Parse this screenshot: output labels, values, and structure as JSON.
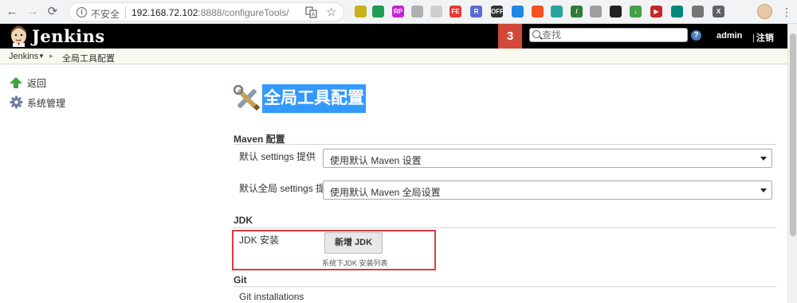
{
  "browser": {
    "security_label": "不安全",
    "url_host": "192.168.72.102",
    "url_rest": ":8888/configureTools/",
    "nav_back": "←",
    "nav_forward": "→",
    "nav_reload": "⟳",
    "extensions": [
      {
        "icon": "extension-icon",
        "color": "#c8b21a",
        "text": ""
      },
      {
        "icon": "extension-icon",
        "color": "#1f9d55",
        "text": ""
      },
      {
        "icon": "extension-icon",
        "color": "#c026d3",
        "text": "RP"
      },
      {
        "icon": "extension-icon",
        "color": "#b0b0b0",
        "text": ""
      },
      {
        "icon": "extension-icon",
        "color": "#cfcfcf",
        "text": ""
      },
      {
        "icon": "extension-icon",
        "color": "#e53935",
        "text": "FE"
      },
      {
        "icon": "extension-icon",
        "color": "#5b6bd6",
        "text": "R"
      },
      {
        "icon": "extension-icon",
        "color": "#333333",
        "text": "OFF"
      },
      {
        "icon": "extension-icon",
        "color": "#1e88e5",
        "text": ""
      },
      {
        "icon": "extension-icon",
        "color": "#f4511e",
        "text": ""
      },
      {
        "icon": "extension-icon",
        "color": "#26a69a",
        "text": ""
      },
      {
        "icon": "extension-icon",
        "color": "#2e7d32",
        "text": "/"
      },
      {
        "icon": "extension-icon",
        "color": "#9e9e9e",
        "text": ""
      },
      {
        "icon": "extension-icon",
        "color": "#222222",
        "text": ""
      },
      {
        "icon": "extension-icon",
        "color": "#43a047",
        "text": "↓"
      },
      {
        "icon": "extension-icon",
        "color": "#c62828",
        "text": "▶"
      },
      {
        "icon": "extension-icon",
        "color": "#00897b",
        "text": ""
      },
      {
        "icon": "extension-icon",
        "color": "#757575",
        "text": ""
      },
      {
        "icon": "extension-icon",
        "color": "#5f6368",
        "text": "X"
      }
    ],
    "menu": "⋮"
  },
  "header": {
    "brand": "Jenkins",
    "notification_count": "3",
    "search_placeholder": "查找",
    "help": "?",
    "user": "admin",
    "logout": "注销",
    "logout_sep": "|"
  },
  "breadcrumb": {
    "root": "Jenkins",
    "current": "全局工具配置"
  },
  "sidebar": {
    "items": [
      {
        "label": "返回"
      },
      {
        "label": "系统管理"
      }
    ]
  },
  "main": {
    "title": "全局工具配置",
    "sections": {
      "maven": {
        "heading": "Maven 配置",
        "settings_label": "默认 settings 提供",
        "settings_value": "使用默认 Maven 设置",
        "global_settings_label": "默认全局 settings 提供",
        "global_settings_value": "使用默认 Maven 全局设置"
      },
      "jdk": {
        "heading": "JDK",
        "install_label": "JDK 安装",
        "add_button": "新增 JDK",
        "hint": "系统下JDK 安装列表"
      },
      "git": {
        "heading": "Git",
        "install_label": "Git installations"
      }
    }
  },
  "colors": {
    "header_bg": "#000000",
    "notification_bg": "#d24939",
    "title_highlight": "#3399ff",
    "annotation_border": "#e03b3b"
  }
}
